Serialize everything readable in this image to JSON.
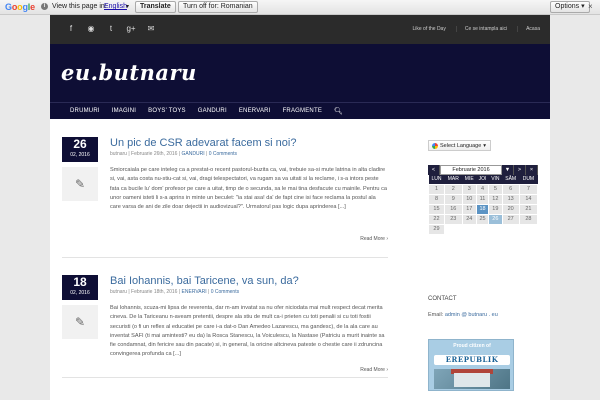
{
  "translate_bar": {
    "logo": "Google",
    "view_text": "View this page in:",
    "language": "English",
    "translate_label": "Translate",
    "turn_off_label": "Turn off for: Romanian",
    "options_label": "Options ▾",
    "close_label": "×"
  },
  "topbar": {
    "social_icons": [
      "facebook-icon",
      "rss-icon",
      "twitter-icon",
      "googleplus-icon",
      "email-icon"
    ],
    "links": [
      "Like of the Day",
      "Ce se intampla aici",
      "Acasa"
    ]
  },
  "site": {
    "logo": "eu.butnaru"
  },
  "nav": {
    "items": [
      "DRUMURI",
      "IMAGINI",
      "BOYS' TOYS",
      "GANDURI",
      "ENERVARI",
      "FRAGMENTE"
    ],
    "search_icon": "search-icon"
  },
  "posts": [
    {
      "day": "26",
      "month_year": "02, 2016",
      "title": "Un pic de CSR adevarat facem si noi?",
      "author": "butnaru",
      "date": "Februarie 26th, 2016",
      "category": "GANDURI",
      "comments": "0 Comments",
      "excerpt": "Smiorcaiala pe care inteleg ca a prestat-o recent pastorul-buzita ca, vai, trebuie sa-si mute latrina in alta cladire si, vai, asta costa nu-stiu-cat si, vai, dragi telespectatori, va rugam sa va uitati si la reclame, i s-a intors peste fata ca bucile lu' dom' profesor pe care a uitat, timp de o secunda, sa le mai tina desfacute cu mainile. Pentru ca unor oameni isteti li s-a aprins in minte un beculet: \"ia stai asa! da' de fapt cine isi face reclama la postul ala care varsa de ani de zile doar dejectii in audiovizual?\". Urmatorul pas logic dupa aprinderea [...]",
      "read_more": "Read More"
    },
    {
      "day": "18",
      "month_year": "02, 2016",
      "title": "Bai Iohannis, bai Taricene, va sun, da?",
      "author": "butnaru",
      "date": "Februarie 18th, 2016",
      "category": "ENERVARI",
      "comments": "0 Comments",
      "excerpt": "Bai Iohannis, scuza-mi lipsa de reverenta, dar m-am invatat sa nu ofer niciodata mai mult respect decat merita cineva. De la Tariceanu n-aveam pretentii, despre ala stiu de mult ca-i prieten cu toti penalii si cu toti fostii securisti (o fi un reflex al educatiei pe care i-a dat-o Dan Amedeo Lazarescu, ma gandesc), de la ala care au inventat SAFI (ti mai amintesti? eu da) la Rosca Stanescu, la Voiculescu, la Nastase (Patriciu a murit inainte sa fie condamnat, din fericire sau din pacate) si, in general, la oricine altcineva pateste o chestie care ii zdruncina convingerea profunda ca [...]",
      "read_more": "Read More"
    }
  ],
  "sidebar": {
    "select_language": "Select Language",
    "calendar": {
      "prev": "<",
      "month": "Februarie 2016",
      "next": ">",
      "weekdays": [
        "LUN",
        "MAR",
        "MIE",
        "JOI",
        "VIN",
        "SÂM",
        "DUM"
      ],
      "weeks": [
        [
          "1",
          "2",
          "3",
          "4",
          "5",
          "6",
          "7"
        ],
        [
          "8",
          "9",
          "10",
          "11",
          "12",
          "13",
          "14"
        ],
        [
          "15",
          "16",
          "17",
          "18",
          "19",
          "20",
          "21"
        ],
        [
          "22",
          "23",
          "24",
          "25",
          "26",
          "27",
          "28"
        ],
        [
          "29",
          "",
          "",
          "",
          "",
          "",
          ""
        ]
      ],
      "highlighted": [
        "18",
        "26"
      ]
    },
    "contact_title": "CONTACT",
    "contact_email_label": "Email:",
    "contact_email": "admin @ butnaru . eu",
    "badge_text": "Proud citizen of",
    "badge_logo": "EREPUBLIK"
  },
  "colors": {
    "header_bg": "#0e0e35",
    "topbar_bg": "#2b2b2b",
    "link": "#3b6b9e",
    "calendar_selected": "#5c94c4"
  }
}
